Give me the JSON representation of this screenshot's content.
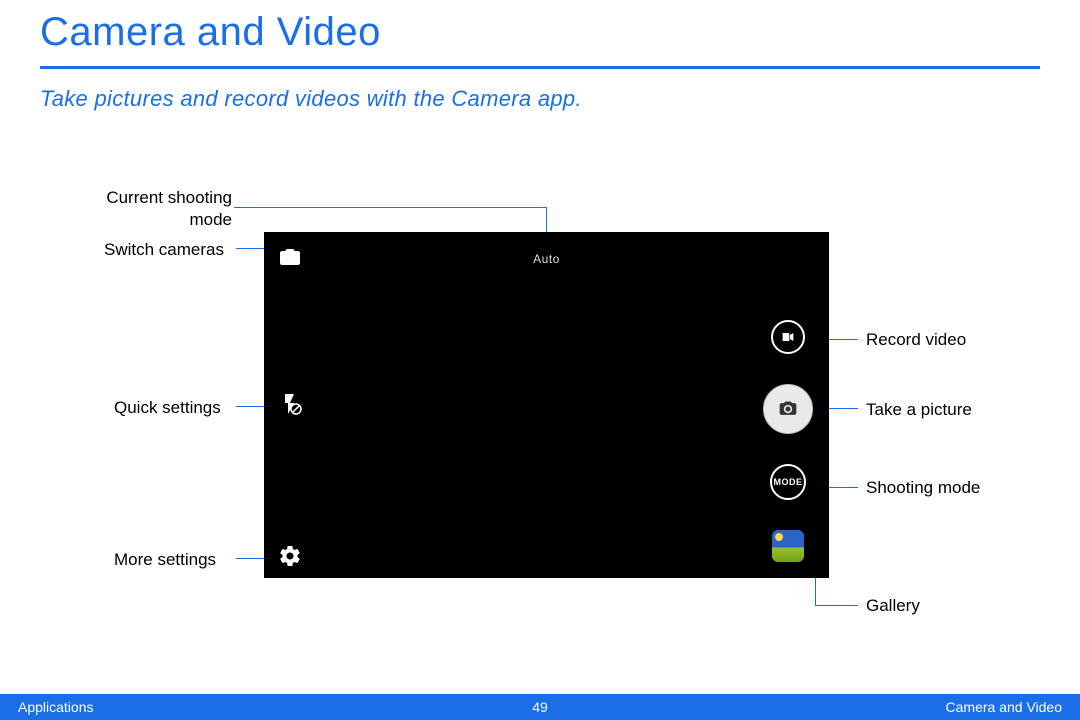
{
  "title": "Camera and Video",
  "subtitle": "Take pictures and record videos with the Camera app.",
  "camera": {
    "mode_label": "Auto",
    "mode_button_text": "MODE"
  },
  "callouts": {
    "current_mode": "Current shooting\nmode",
    "switch_cameras": "Switch cameras",
    "quick_settings": "Quick settings",
    "more_settings": "More settings",
    "record_video": "Record video",
    "take_picture": "Take a picture",
    "shooting_mode": "Shooting mode",
    "gallery": "Gallery"
  },
  "footer": {
    "left": "Applications",
    "page": "49",
    "right": "Camera and Video"
  }
}
